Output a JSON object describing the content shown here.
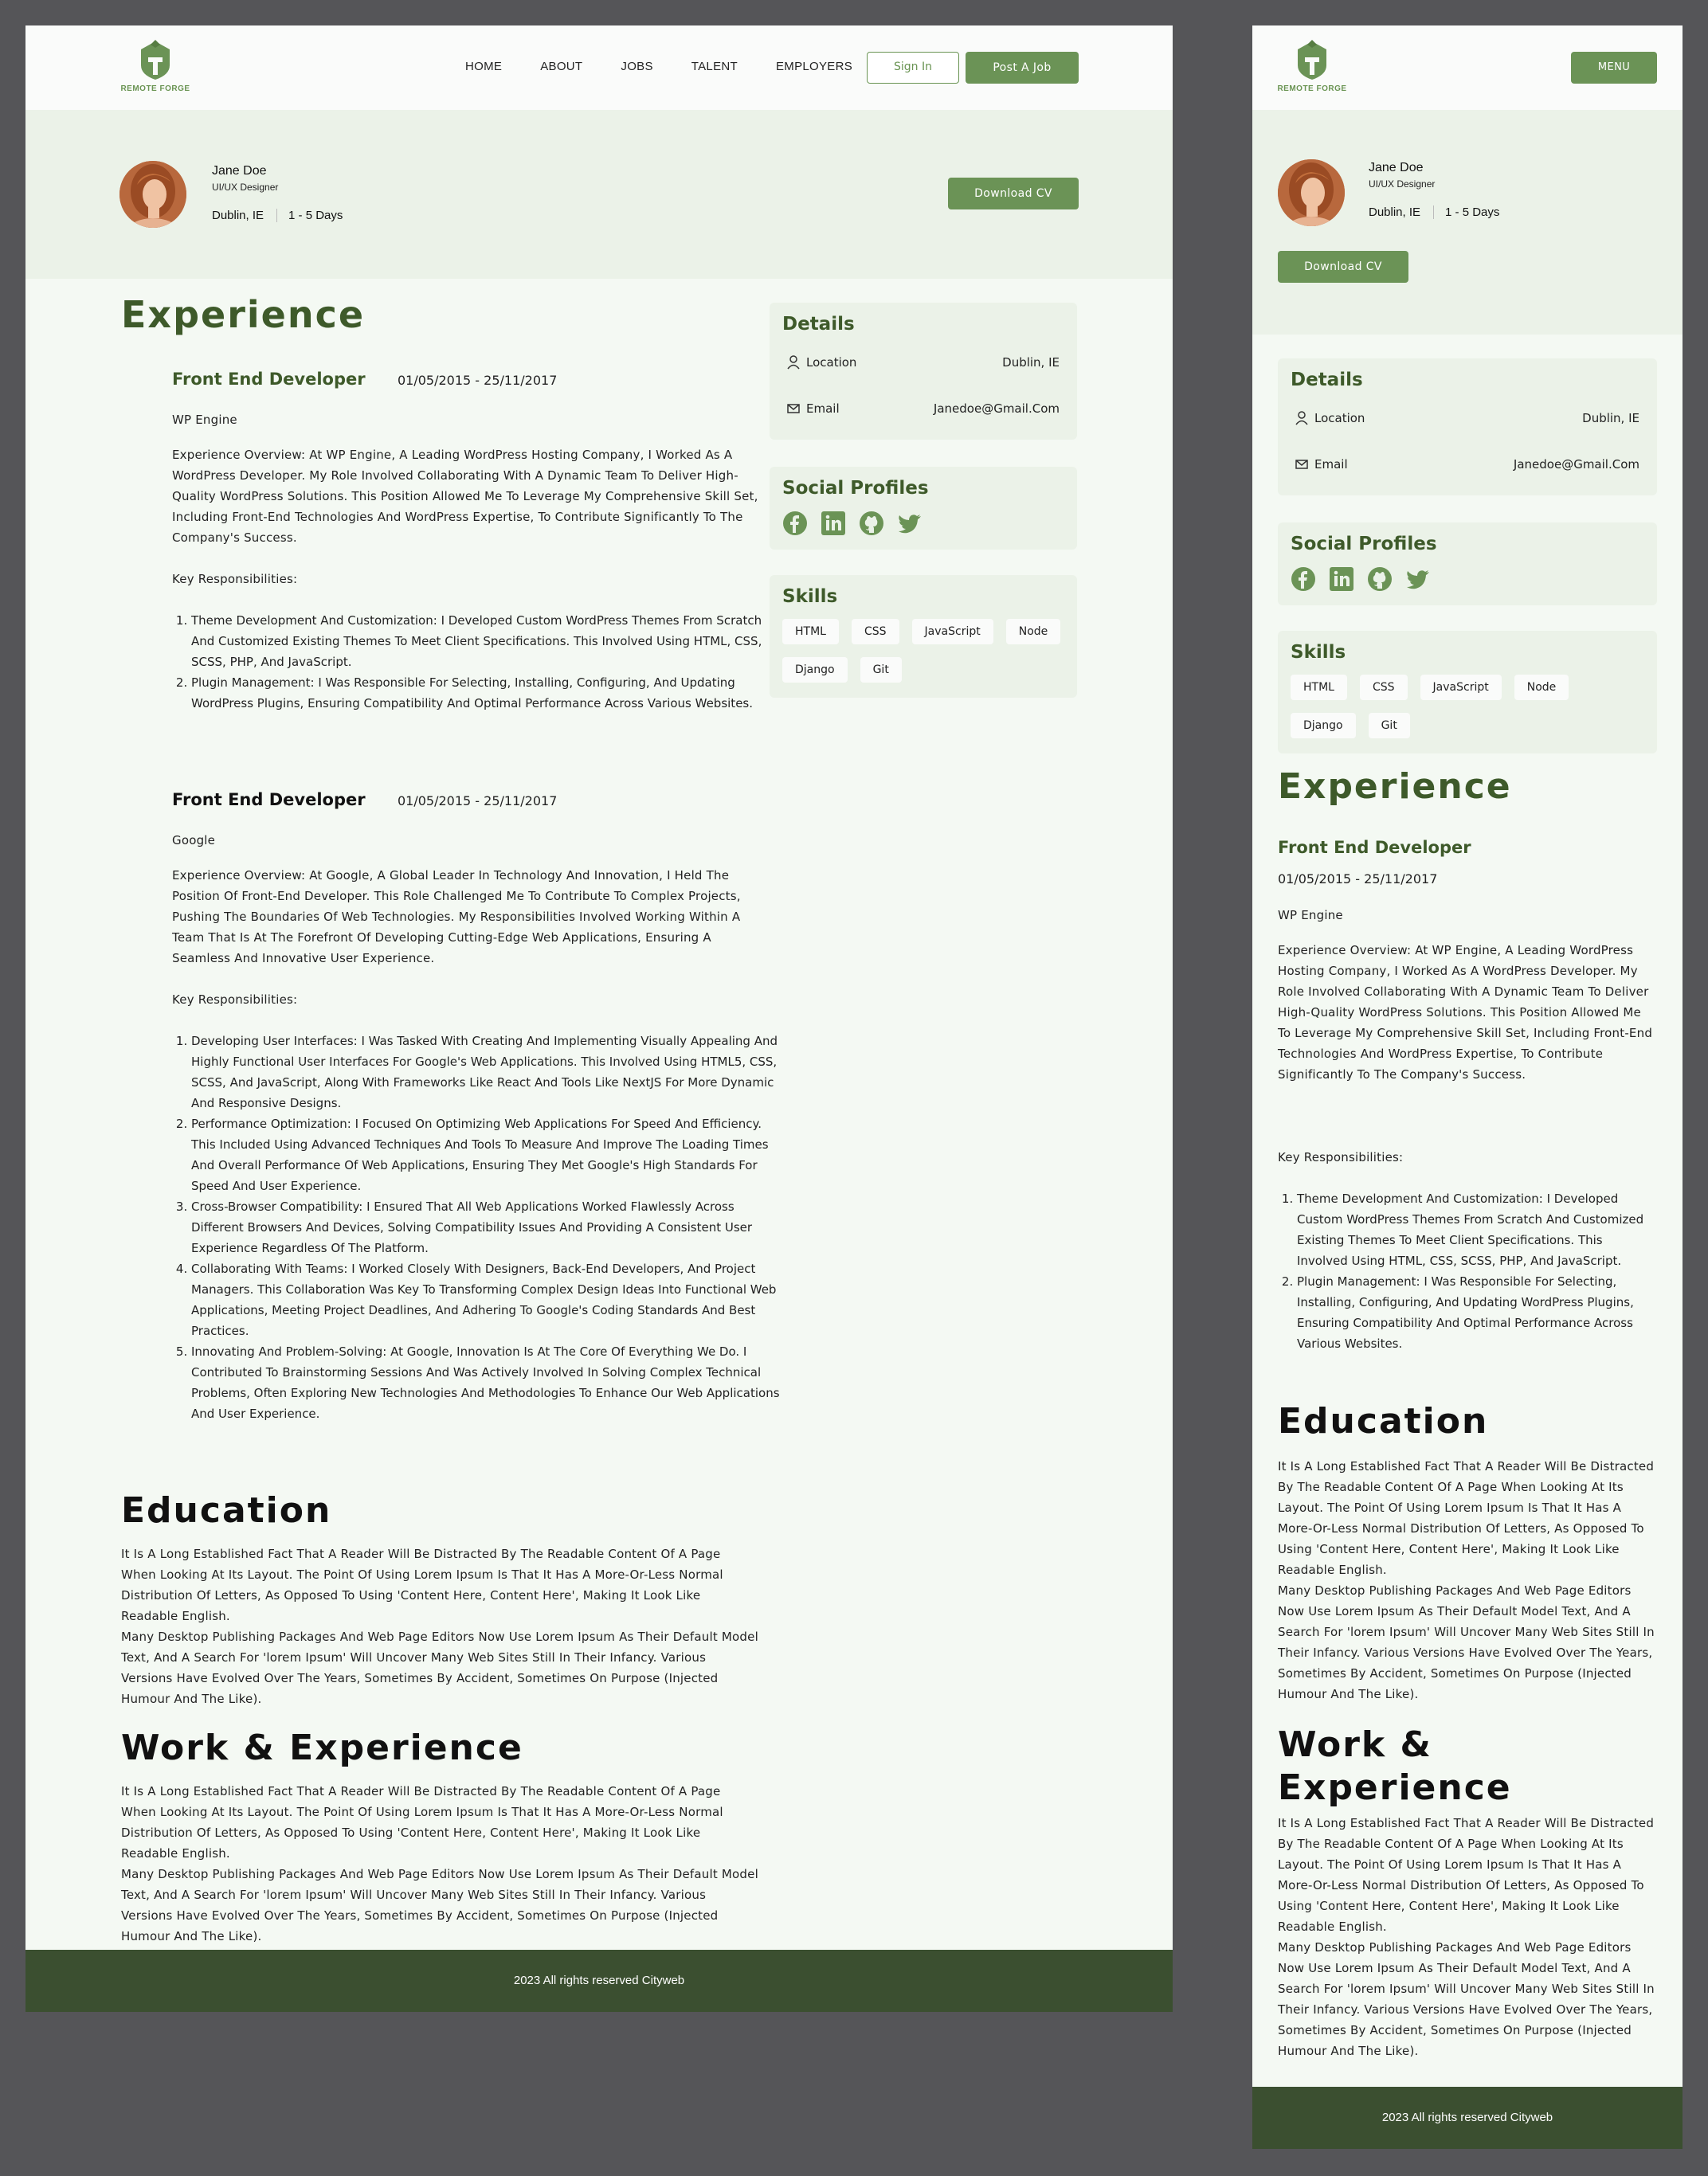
{
  "brand": {
    "name": "REMOTE FORGE",
    "accent": "#6b9356",
    "dark": "#3e5a2a",
    "footer_bg": "#3b4f30",
    "band_bg": "#ebf2e8"
  },
  "nav": {
    "items": [
      "HOME",
      "ABOUT",
      "JOBS",
      "TALENT",
      "EMPLOYERS"
    ],
    "sign_in": "Sign In",
    "post_job": "Post A Job",
    "menu": "MENU"
  },
  "profile": {
    "name": "Jane Doe",
    "role": "UI/UX Designer",
    "location": "Dublin, IE",
    "availability": "1 - 5 Days",
    "download_cv": "Download CV"
  },
  "experience": {
    "heading": "Experience",
    "key_resp_label": "Key Responsibilities:",
    "jobs": [
      {
        "title": "Front End Developer",
        "dates": "01/05/2015 - 25/11/2017",
        "company": "WP Engine",
        "overview": "Experience Overview: At WP Engine, A Leading WordPress Hosting Company, I Worked As A WordPress Developer. My Role Involved Collaborating With A Dynamic Team To Deliver High-Quality WordPress Solutions. This Position Allowed Me To Leverage My Comprehensive Skill Set, Including Front-End Technologies And WordPress Expertise, To Contribute Significantly To The Company's Success.",
        "responsibilities": [
          "Theme Development And Customization: I Developed Custom WordPress Themes From Scratch And Customized Existing Themes To Meet Client Specifications. This Involved Using HTML, CSS, SCSS, PHP, And JavaScript.",
          "Plugin Management: I Was Responsible For Selecting, Installing, Configuring, And Updating WordPress Plugins, Ensuring Compatibility And Optimal Performance Across Various Websites."
        ]
      },
      {
        "title": "Front End Developer",
        "dates": "01/05/2015 - 25/11/2017",
        "company": "Google",
        "overview": "Experience Overview: At Google, A Global Leader In Technology And Innovation, I Held The Position Of Front-End Developer. This Role Challenged Me To Contribute To Complex Projects, Pushing The Boundaries Of Web Technologies. My Responsibilities Involved Working Within A Team That Is At The Forefront Of Developing Cutting-Edge Web Applications, Ensuring A Seamless And Innovative User Experience.",
        "responsibilities": [
          "Developing User Interfaces: I Was Tasked With Creating And Implementing Visually Appealing And Highly Functional User Interfaces For Google's Web Applications. This Involved Using HTML5, CSS, SCSS, And JavaScript, Along With Frameworks Like React And Tools Like NextJS For More Dynamic And Responsive Designs.",
          "Performance Optimization: I Focused On Optimizing Web Applications For Speed And Efficiency. This Included Using Advanced Techniques And Tools To Measure And Improve The Loading Times And Overall Performance Of Web Applications, Ensuring They Met Google's High Standards For Speed And User Experience.",
          "Cross-Browser Compatibility: I Ensured That All Web Applications Worked Flawlessly Across Different Browsers And Devices, Solving Compatibility Issues And Providing A Consistent User Experience Regardless Of The Platform.",
          "Collaborating With Teams: I Worked Closely With Designers, Back-End Developers, And Project Managers. This Collaboration Was Key To Transforming Complex Design Ideas Into Functional Web Applications, Meeting Project Deadlines, And Adhering To Google's Coding Standards And Best Practices.",
          "Innovating And Problem-Solving: At Google, Innovation Is At The Core Of Everything We Do. I Contributed To Brainstorming Sessions And Was Actively Involved In Solving Complex Technical Problems, Often Exploring New Technologies And Methodologies To Enhance Our Web Applications And User Experience."
        ]
      }
    ]
  },
  "education": {
    "heading": "Education",
    "p1": "It Is A Long Established Fact That A Reader Will Be Distracted By The Readable Content Of A Page When Looking At Its Layout. The Point Of Using Lorem Ipsum Is That It Has A More-Or-Less Normal Distribution Of Letters, As Opposed To Using 'Content Here, Content Here', Making It Look Like Readable English.",
    "p2": "Many Desktop Publishing Packages And Web Page Editors Now Use Lorem Ipsum As Their Default Model Text, And A Search For 'lorem Ipsum' Will Uncover Many Web Sites Still In Their Infancy. Various Versions Have Evolved Over The Years, Sometimes By Accident, Sometimes On Purpose (Injected Humour And The Like)."
  },
  "work": {
    "heading": "Work & Experience",
    "p1": "It Is A Long Established Fact That A Reader Will Be Distracted By The Readable Content Of A Page When Looking At Its Layout. The Point Of Using Lorem Ipsum Is That It Has A More-Or-Less Normal Distribution Of Letters, As Opposed To Using 'Content Here, Content Here', Making It Look Like Readable English.",
    "p2": "Many Desktop Publishing Packages And Web Page Editors Now Use Lorem Ipsum As Their Default Model Text, And A Search For 'lorem Ipsum' Will Uncover Many Web Sites Still In Their Infancy. Various Versions Have Evolved Over The Years, Sometimes By Accident, Sometimes On Purpose (Injected Humour And The Like)."
  },
  "details": {
    "title": "Details",
    "location_label": "Location",
    "location_value": "Dublin, IE",
    "email_label": "Email",
    "email_value": "Janedoe@Gmail.Com"
  },
  "social": {
    "title": "Social Profiles",
    "icons": [
      "facebook-icon",
      "linkedin-icon",
      "github-icon",
      "twitter-icon"
    ]
  },
  "skills": {
    "title": "Skills",
    "items": [
      "HTML",
      "CSS",
      "JavaScript",
      "Node",
      "Django",
      "Git"
    ]
  },
  "footer": {
    "text": "2023 All rights reserved Cityweb"
  }
}
